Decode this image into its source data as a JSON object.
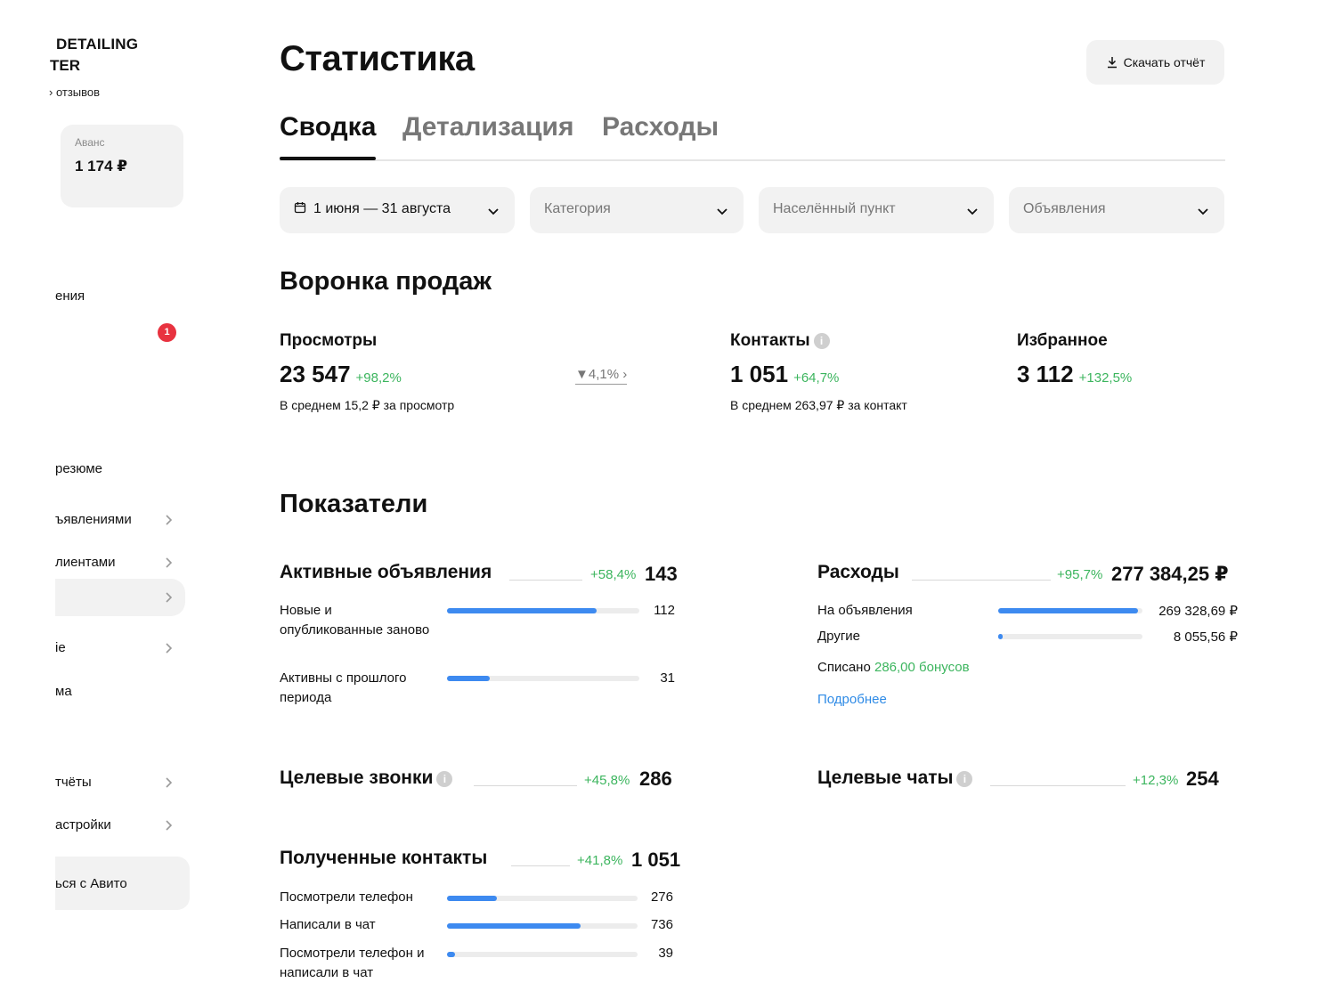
{
  "sidebar": {
    "brand_line1": "DETAILING",
    "brand_line2": "TER",
    "reviews": "› отзывов",
    "avans": {
      "label": "Аванс",
      "value": "1 174 ₽"
    },
    "items": [
      {
        "label": "ения"
      },
      {
        "label": "резюме"
      },
      {
        "label": "ъявлениями"
      },
      {
        "label": "лиентами"
      },
      {
        "label": ""
      },
      {
        "label": "ie"
      },
      {
        "label": "ма"
      },
      {
        "label": "тчёты"
      },
      {
        "label": "астройки"
      }
    ],
    "badge": "1",
    "help": "ься с Авито"
  },
  "header": {
    "title": "Статистика",
    "download_label": "Скачать отчёт"
  },
  "tabs": [
    {
      "label": "Сводка",
      "active": true
    },
    {
      "label": "Детализация",
      "active": false
    },
    {
      "label": "Расходы",
      "active": false
    }
  ],
  "filters": {
    "period": "1 июня — 31 августа",
    "category": "Категория",
    "location": "Населённый пункт",
    "ads": "Объявления"
  },
  "funnel": {
    "title": "Воронка продаж",
    "views": {
      "label": "Просмотры",
      "value": "23 547",
      "delta": "+98,2%",
      "sub": "В среднем 15,2 ₽ за просмотр",
      "trend": "▼4,1% ›"
    },
    "contacts": {
      "label": "Контакты",
      "value": "1 051",
      "delta": "+64,7%",
      "sub": "В среднем 263,97 ₽ за контакт"
    },
    "favorites": {
      "label": "Избранное",
      "value": "3 112",
      "delta": "+132,5%"
    }
  },
  "indicators": {
    "title": "Показатели",
    "active_ads": {
      "title": "Активные объявления",
      "delta": "+58,4%",
      "total": "143",
      "rows": [
        {
          "label": "Новые и опубликованные заново",
          "value": "112",
          "fraction": 0.78
        },
        {
          "label": "Активны с прошлого периода",
          "value": "31",
          "fraction": 0.22
        }
      ]
    },
    "expenses": {
      "title": "Расходы",
      "delta": "+95,7%",
      "total": "277 384,25 ₽",
      "rows": [
        {
          "label": "На объявления",
          "value": "269 328,69 ₽",
          "fraction": 0.97
        },
        {
          "label": "Другие",
          "value": "8 055,56 ₽",
          "fraction": 0.03
        }
      ],
      "written_prefix": "Списано",
      "written_value": "286,00 бонусов",
      "more": "Подробнее"
    },
    "target_calls": {
      "title": "Целевые звонки",
      "delta": "+45,8%",
      "total": "286"
    },
    "target_chats": {
      "title": "Целевые чаты",
      "delta": "+12,3%",
      "total": "254"
    },
    "received_contacts": {
      "title": "Полученные контакты",
      "delta": "+41,8%",
      "total": "1 051",
      "rows": [
        {
          "label": "Посмотрели телефон",
          "value": "276",
          "fraction": 0.26
        },
        {
          "label": "Написали в чат",
          "value": "736",
          "fraction": 0.7
        },
        {
          "label": "Посмотрели телефон и написали в чат",
          "value": "39",
          "fraction": 0.04
        }
      ]
    }
  },
  "colors": {
    "accent": "#3d8af0",
    "positive": "#3cb55e",
    "link": "#2f8be6",
    "badge": "#e8323f"
  },
  "icons": [
    "download-icon",
    "calendar-icon",
    "chevron-down-icon",
    "chevron-right-icon",
    "info-icon"
  ]
}
